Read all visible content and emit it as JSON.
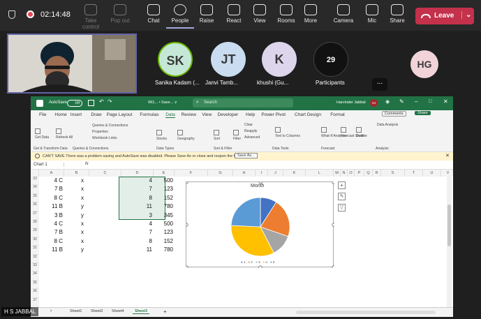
{
  "topbar": {
    "time": "02:14:48",
    "items": [
      {
        "label": "Take control",
        "icon": "take-control-icon",
        "dim": true
      },
      {
        "label": "Pop out",
        "icon": "pop-out-icon",
        "dim": true
      },
      {
        "label": "Chat",
        "icon": "chat-icon",
        "dim": false
      },
      {
        "label": "People",
        "icon": "people-icon",
        "dim": false
      },
      {
        "label": "Raise",
        "icon": "raise-hand-icon",
        "dim": false
      },
      {
        "label": "React",
        "icon": "react-icon",
        "dim": false
      },
      {
        "label": "View",
        "icon": "view-icon",
        "dim": false
      },
      {
        "label": "Rooms",
        "icon": "rooms-icon",
        "dim": false
      },
      {
        "label": "More",
        "icon": "more-icon",
        "dim": false
      },
      {
        "label": "Camera",
        "icon": "camera-off-icon",
        "dim": false
      },
      {
        "label": "Mic",
        "icon": "mic-off-icon",
        "dim": false
      },
      {
        "label": "Share",
        "icon": "share-icon",
        "dim": false
      }
    ],
    "leave_label": "Leave"
  },
  "participants": [
    {
      "initials": "SK",
      "name": "Sanika Kadam (...",
      "color": "#c5e8d6"
    },
    {
      "initials": "JT",
      "name": "Janvi Tamb...",
      "color": "#c9dcf0"
    },
    {
      "initials": "K",
      "name": "khushi (Gu...",
      "color": "#dcd5ec"
    },
    {
      "initials": "29",
      "name": "Participants",
      "color": "#111111"
    },
    {
      "initials": "HG",
      "name": "",
      "color": "#f2d3da"
    }
  ],
  "overflow_label": "...",
  "excel": {
    "autosave": "AutoSave",
    "autosave_state": "Off",
    "filename": "Wi1... • Save... ∨",
    "search_placeholder": "Search",
    "user": "Harvinder Jabbal",
    "user_initials": "HJ",
    "menu": [
      "File",
      "Home",
      "Insert",
      "Draw",
      "Page Layout",
      "Formulas",
      "Data",
      "Review",
      "View",
      "Developer",
      "Help",
      "Power Pivot",
      "Chart Design",
      "Format"
    ],
    "comments": "Comments",
    "share": "Share",
    "ribbon_groups": [
      "Get & Transform Data",
      "Queries & Connections",
      "Data Types",
      "Sort & Filter",
      "Data Tools",
      "Forecast",
      "Analysis"
    ],
    "ribbon_labels": [
      "Get Data",
      "Refresh All",
      "Queries & Connections",
      "Properties",
      "Workbook Links",
      "Stocks",
      "Geography",
      "Sort",
      "Filter",
      "Clear",
      "Reapply",
      "Advanced",
      "Text to Columns",
      "What-If Analysis",
      "Forecast Sheet",
      "Outline",
      "Data Analysis"
    ],
    "warning": "CAN'T SAVE  There was a problem saving and AutoSave was disabled. Please Save As or close and reopen the file.",
    "warning_button": "Save As...",
    "namebox": "Chart 1",
    "fx": "fx",
    "columns": [
      "A",
      "B",
      "C",
      "D",
      "E",
      "F",
      "G",
      "H",
      "I",
      "J",
      "K",
      "L",
      "M",
      "N",
      "O",
      "P",
      "Q",
      "R",
      "S",
      "T",
      "U",
      "V"
    ],
    "rows": [
      {
        "num": "23",
        "a": "4 C",
        "c": "x",
        "d": "4",
        "e": "500"
      },
      {
        "num": "24",
        "a": "7 B",
        "c": "x",
        "d": "7",
        "e": "123"
      },
      {
        "num": "25",
        "a": "8 C",
        "c": "x",
        "d": "8",
        "e": "152"
      },
      {
        "num": "26",
        "a": "11 B",
        "c": "y",
        "d": "11",
        "e": "780"
      },
      {
        "num": "27",
        "a": "3 B",
        "c": "y",
        "d": "3",
        "e": "345"
      },
      {
        "num": "28",
        "a": "4 C",
        "c": "x",
        "d": "4",
        "e": "500"
      },
      {
        "num": "29",
        "a": "7 B",
        "c": "x",
        "d": "7",
        "e": "123"
      },
      {
        "num": "30",
        "a": "8 C",
        "c": "x",
        "d": "8",
        "e": "152"
      },
      {
        "num": "31",
        "a": "11 B",
        "c": "y",
        "d": "11",
        "e": "780"
      },
      {
        "num": "32",
        "a": "",
        "c": "",
        "d": "",
        "e": ""
      },
      {
        "num": "33",
        "a": "",
        "c": "",
        "d": "",
        "e": ""
      },
      {
        "num": "34",
        "a": "",
        "c": "",
        "d": "",
        "e": ""
      },
      {
        "num": "35",
        "a": "",
        "c": "",
        "d": "",
        "e": ""
      },
      {
        "num": "36",
        "a": "",
        "c": "",
        "d": "",
        "e": ""
      },
      {
        "num": "37",
        "a": "",
        "c": "",
        "d": "",
        "e": ""
      }
    ],
    "sheets": [
      "Sheet1",
      "Sheet2",
      "Sheet4",
      "Sheet3"
    ],
    "active_sheet": "Sheet3",
    "add_sheet": "+"
  },
  "chart_data": {
    "type": "pie",
    "title": "Month",
    "categories": [
      "1",
      "2",
      "3",
      "4",
      "5"
    ],
    "values": [
      3,
      7,
      4,
      11,
      8
    ],
    "colors": [
      "#4472c4",
      "#ed7d31",
      "#a5a5a5",
      "#ffc000",
      "#5b9bd5",
      "#70ad47"
    ],
    "legend": "bottom"
  },
  "name_badge": "H S JABBAL"
}
